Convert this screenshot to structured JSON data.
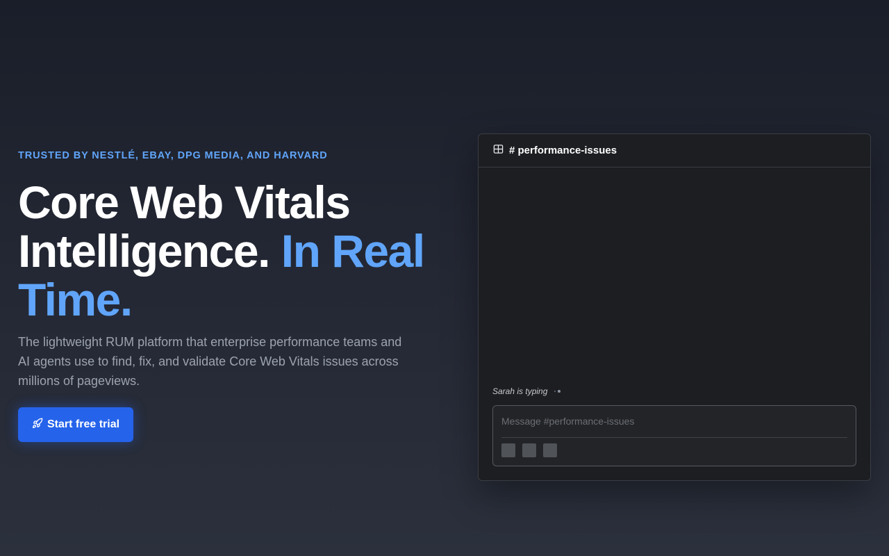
{
  "hero": {
    "eyebrow": "TRUSTED BY NESTLÉ, EBAY, DPG MEDIA, AND HARVARD",
    "headline_line1": "Core Web Vitals",
    "headline_line2": "Intelligence.",
    "headline_accent": "In Real Time.",
    "subtext": "The lightweight RUM platform that enterprise performance teams and AI agents use to find, fix, and validate Core Web Vitals issues across millions of pageviews.",
    "cta_label": "Start free trial",
    "cta_icon": "rocket-icon"
  },
  "chat": {
    "header_icon": "grid-icon",
    "channel": "# performance-issues",
    "typing_indicator": "Sarah is typing",
    "composer_placeholder": "Message #performance-issues",
    "composer_tools": [
      "format-tool",
      "attach-tool",
      "emoji-tool"
    ]
  },
  "colors": {
    "accent": "#60a5fa",
    "button": "#2563eb",
    "panel_bg": "#1c1e22"
  }
}
